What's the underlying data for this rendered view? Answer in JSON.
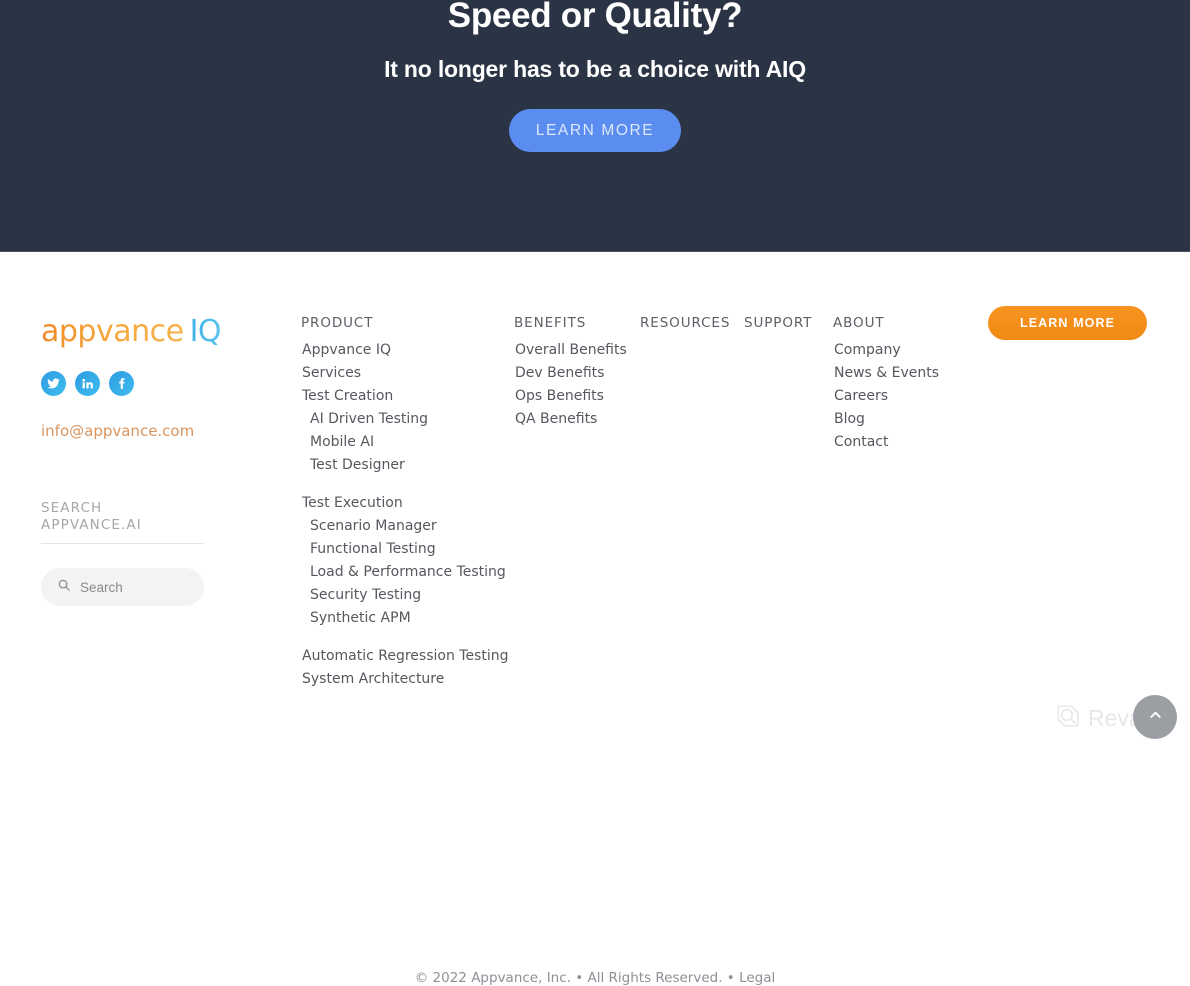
{
  "hero": {
    "title": "Speed or Quality?",
    "subtitle": "It no longer has to be a choice with AIQ",
    "cta_label": "LEARN MORE",
    "bg_color": "#2b3445",
    "cta_color": "#5b8df0"
  },
  "footer": {
    "logo": {
      "primary": "appvance",
      "secondary": "IQ",
      "primary_color": "#f29224",
      "secondary_color": "#45b8ec"
    },
    "social": [
      {
        "name": "twitter",
        "label": "Twitter"
      },
      {
        "name": "linkedin",
        "label": "LinkedIn"
      },
      {
        "name": "facebook",
        "label": "Facebook"
      }
    ],
    "email": "info@appvance.com",
    "email_color": "#d9955f",
    "search": {
      "heading": "SEARCH APPVANCE.AI",
      "placeholder": "Search",
      "value": ""
    },
    "cta_label": "LEARN MORE",
    "cta_color": "#f79420",
    "columns": [
      {
        "key": "product",
        "heading": "PRODUCT",
        "items": [
          {
            "label": "Appvance IQ",
            "level": 1
          },
          {
            "label": "Services",
            "level": 1
          },
          {
            "label": "Test Creation",
            "level": 1
          },
          {
            "label": "AI Driven Testing",
            "level": 2
          },
          {
            "label": "Mobile AI",
            "level": 2
          },
          {
            "label": "Test Designer",
            "level": 2
          },
          {
            "label": "",
            "level": 0
          },
          {
            "label": "Test Execution",
            "level": 1
          },
          {
            "label": "Scenario Manager",
            "level": 2
          },
          {
            "label": "Functional Testing",
            "level": 2
          },
          {
            "label": "Load & Performance Testing",
            "level": 2
          },
          {
            "label": "Security Testing",
            "level": 2
          },
          {
            "label": "Synthetic APM",
            "level": 2
          },
          {
            "label": "",
            "level": 0
          },
          {
            "label": "Automatic Regression Testing",
            "level": 1
          },
          {
            "label": "System Architecture",
            "level": 1
          }
        ]
      },
      {
        "key": "benefits",
        "heading": "BENEFITS",
        "items": [
          {
            "label": "Overall Benefits",
            "level": 1
          },
          {
            "label": "Dev Benefits",
            "level": 1
          },
          {
            "label": "Ops Benefits",
            "level": 1
          },
          {
            "label": "QA Benefits",
            "level": 1
          }
        ]
      },
      {
        "key": "resources",
        "heading": "RESOURCES",
        "items": []
      },
      {
        "key": "support",
        "heading": "SUPPORT",
        "items": []
      },
      {
        "key": "about",
        "heading": "ABOUT",
        "items": [
          {
            "label": "Company",
            "level": 1
          },
          {
            "label": "News & Events",
            "level": 1
          },
          {
            "label": "Careers",
            "level": 1
          },
          {
            "label": "Blog",
            "level": 1
          },
          {
            "label": "Contact",
            "level": 1
          }
        ]
      }
    ],
    "copyright": "© 2022 Appvance, Inc. • All Rights Reserved. • ",
    "legal_label": "Legal"
  },
  "overlay": {
    "watermark_text": "Revain",
    "scroll_top_label": "Back to top"
  }
}
